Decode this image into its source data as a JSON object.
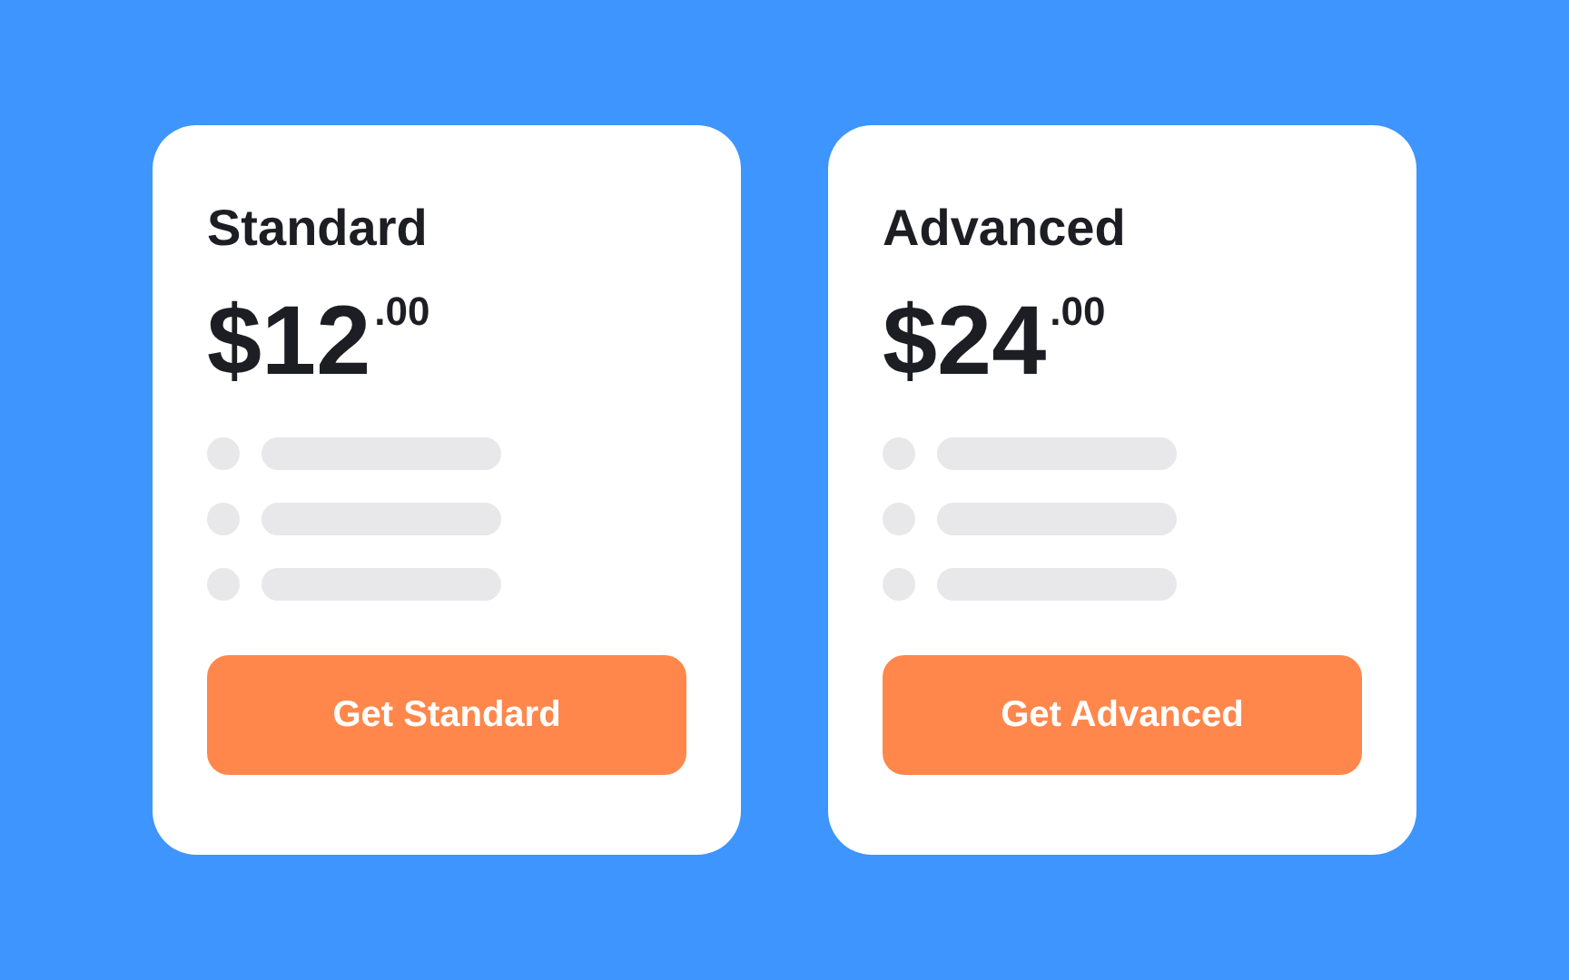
{
  "plans": [
    {
      "name": "Standard",
      "price": "$12",
      "cents": ".00",
      "features": [
        {
          "kind": "placeholder"
        },
        {
          "kind": "placeholder"
        },
        {
          "kind": "placeholder"
        }
      ],
      "button": "Get Standard"
    },
    {
      "name": "Advanced",
      "price": "$24",
      "cents": ".00",
      "features": [
        {
          "kind": "placeholder"
        },
        {
          "kind": "placeholder"
        },
        {
          "kind": "placeholder"
        }
      ],
      "button": "Get Advanced"
    }
  ]
}
